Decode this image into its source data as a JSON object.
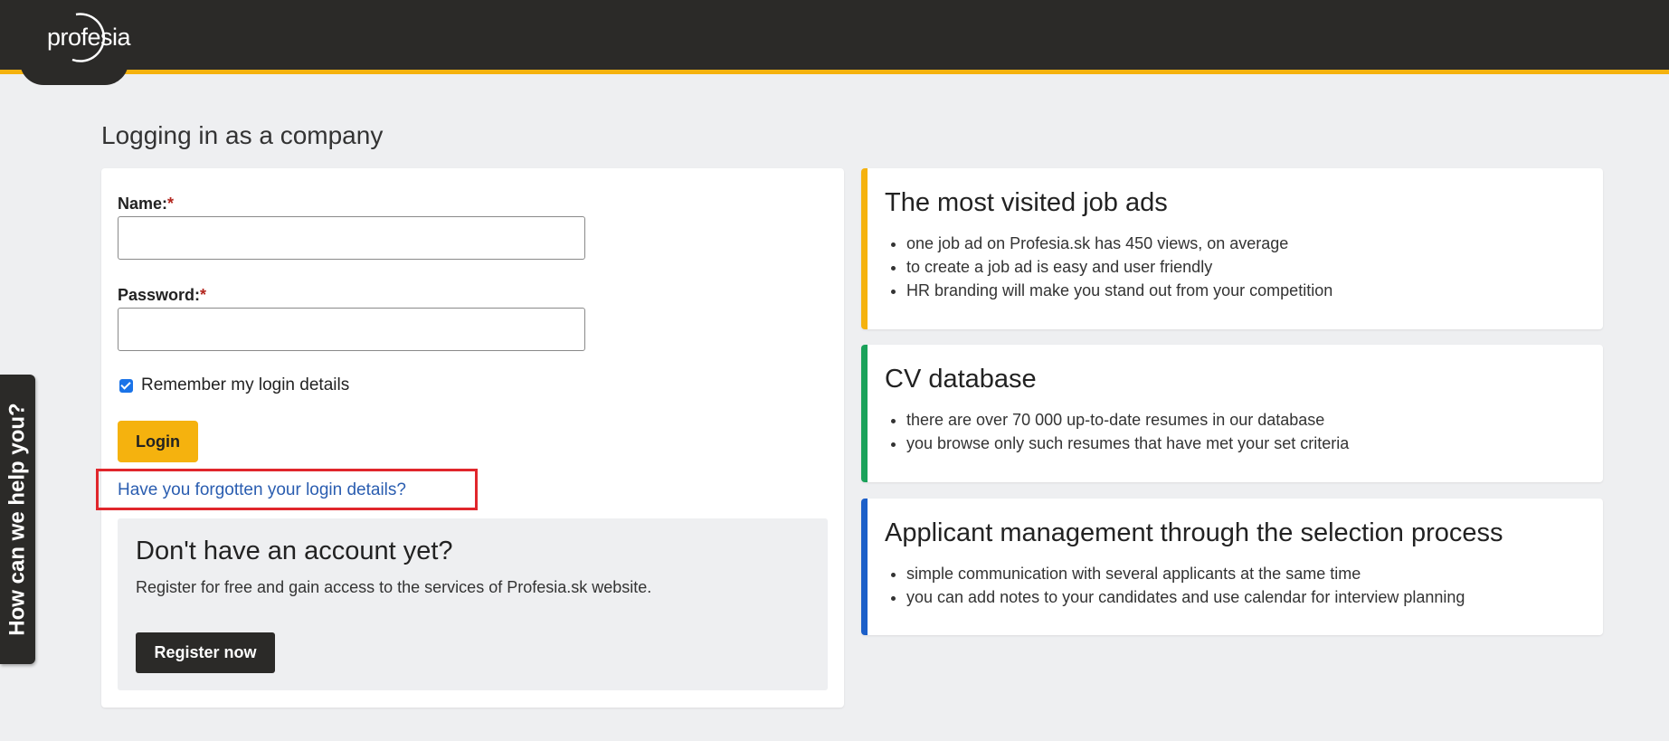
{
  "header": {
    "logo_text": "profesia",
    "colors": {
      "bar": "#2b2a28",
      "accent": "#f5b20e"
    }
  },
  "help_tab": {
    "label": "How can we help you?"
  },
  "page_title": "Logging in as a company",
  "login_form": {
    "name_label": "Name:",
    "password_label": "Password:",
    "required_mark": "*",
    "name_value": "",
    "password_value": "",
    "remember_label": "Remember my login details",
    "remember_checked": true,
    "login_button": "Login",
    "forgot_link": "Have you forgotten your login details?"
  },
  "register": {
    "title": "Don't have an account yet?",
    "text": "Register for free and gain access to the services of Profesia.sk website.",
    "button": "Register now"
  },
  "info_cards": [
    {
      "title": "The most visited job ads",
      "accent": "#f5b20e",
      "items": [
        "one job ad on Profesia.sk has 450 views, on average",
        "to create a job ad is easy and user friendly",
        "HR branding will make you stand out from your competition"
      ]
    },
    {
      "title": "CV database",
      "accent": "#1aa25a",
      "items": [
        "there are over 70 000 up-to-date resumes in our database",
        "you browse only such resumes that have met your set criteria"
      ]
    },
    {
      "title": "Applicant management through the selection process",
      "accent": "#1b5fc9",
      "items": [
        "simple communication with several applicants at the same time",
        "you can add notes to your candidates and use calendar for interview planning"
      ]
    }
  ]
}
